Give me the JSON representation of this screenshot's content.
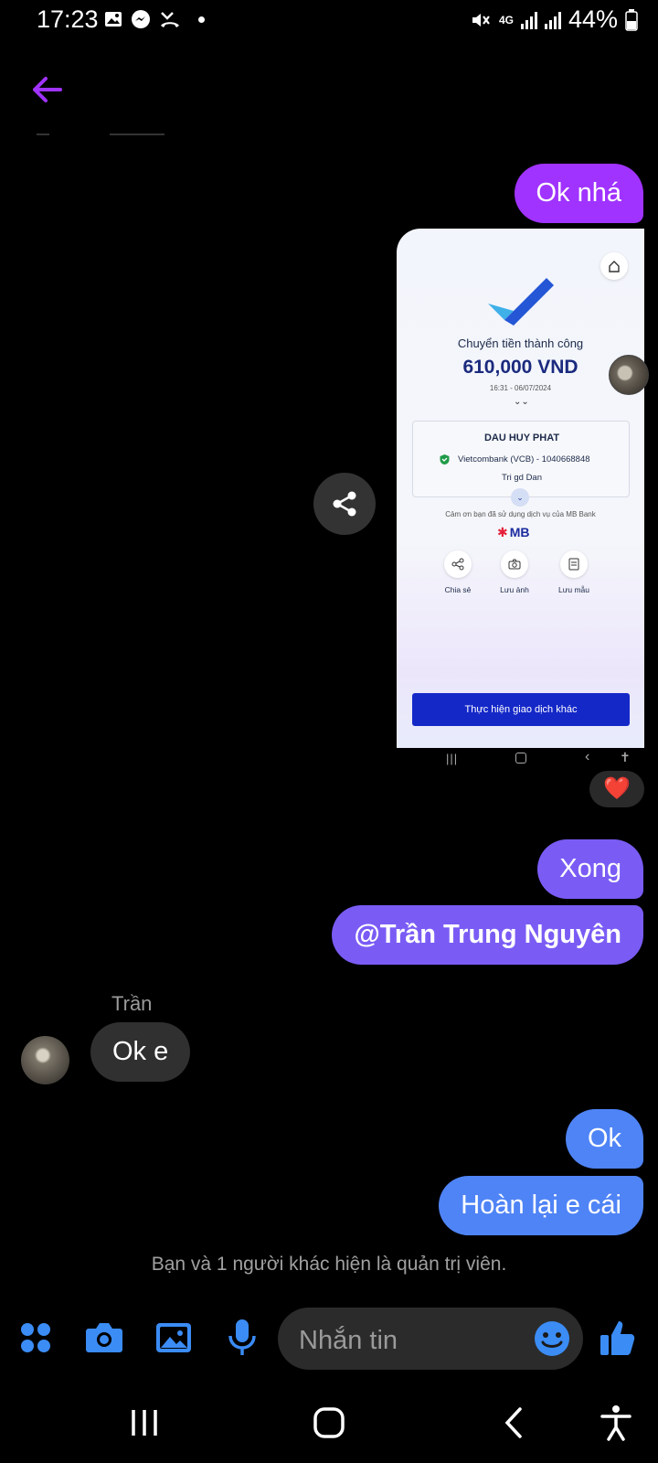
{
  "status_bar": {
    "time": "17:23",
    "network": "4G",
    "battery": "44%",
    "left_icons": [
      "image-icon",
      "messenger-icon",
      "missed-call-icon",
      "dot-icon"
    ],
    "right_icons": [
      "mute-icon",
      "signal-icon",
      "signal-icon",
      "battery-icon"
    ]
  },
  "header": {
    "back_icon": "arrow-left-icon",
    "accent": "#a033ff"
  },
  "messages": [
    {
      "id": "m1",
      "side": "out",
      "text": "Ok nhá",
      "color": "#a033ff"
    },
    {
      "id": "m2",
      "side": "out",
      "type": "image",
      "reaction": "❤️"
    },
    {
      "id": "m3",
      "side": "out",
      "text": "Xong",
      "color": "#7a5cf5"
    },
    {
      "id": "m4",
      "side": "out",
      "text": "@Trần Trung Nguyên",
      "color": "#7a5cf5"
    },
    {
      "id": "m5",
      "side": "in",
      "sender": "Trần",
      "text": "Ok e"
    },
    {
      "id": "m6",
      "side": "out",
      "text": "Ok",
      "color": "#4f84f6"
    },
    {
      "id": "m7",
      "side": "out",
      "text": "Hoàn lại e cái",
      "color": "#4f84f6"
    }
  ],
  "shared_screenshot": {
    "title": "Chuyển tiền thành công",
    "amount": "610,000 VND",
    "datetime": "16:31 - 06/07/2024",
    "recipient": "DAU HUY PHAT",
    "bank": "Vietcombank (VCB) - 1040668848",
    "note": "Tri gd Dan",
    "thanks": "Cảm ơn bạn đã sử dụng dịch vụ của MB Bank",
    "brand": "MB",
    "actions": [
      "Chia sẻ",
      "Lưu ảnh",
      "Lưu mẫu"
    ],
    "cta": "Thực hiện giao dịch khác"
  },
  "system_note": "Bạn và 1 người khác hiện là quản trị viên.",
  "composer": {
    "placeholder": "Nhắn tin",
    "icons": [
      "apps-icon",
      "camera-icon",
      "gallery-icon",
      "mic-icon",
      "emoji-icon",
      "thumbs-up-icon"
    ],
    "accent": "#3b8cf5"
  },
  "nav_bar": [
    "recents-icon",
    "home-icon",
    "back-icon",
    "accessibility-icon"
  ]
}
